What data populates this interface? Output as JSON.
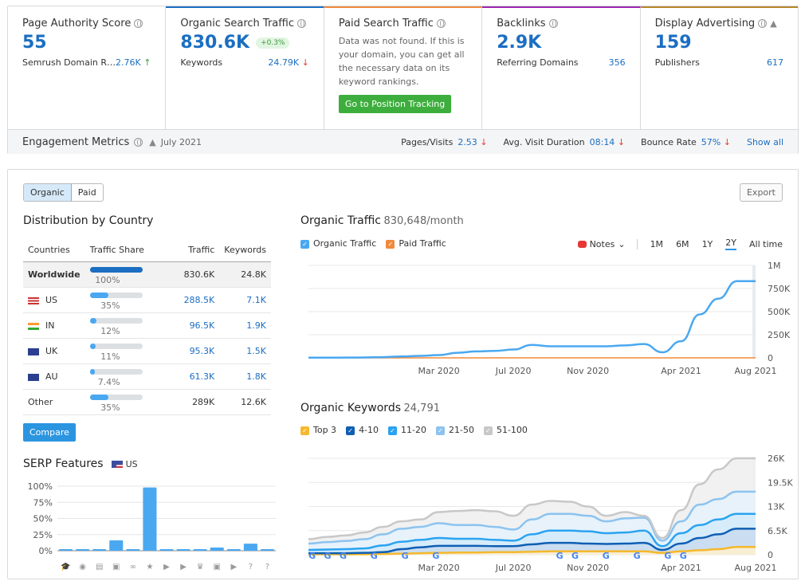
{
  "cards": [
    {
      "title": "Page Authority Score",
      "value": "55",
      "sub_label": "Semrush Domain R…",
      "sub_value": "2.76K",
      "trend": "up",
      "accent": ""
    },
    {
      "title": "Organic Search Traffic",
      "value": "830.6K",
      "badge": "+0.3%",
      "sub_label": "Keywords",
      "sub_value": "24.79K",
      "trend": "down",
      "accent": "#1b6ec2"
    },
    {
      "title": "Paid Search Traffic",
      "message": "Data was not found. If this is your domain, you can get all the necessary data on its keyword rankings.",
      "button": "Go to Position Tracking",
      "accent": "#f08a3c"
    },
    {
      "title": "Backlinks",
      "value": "2.9K",
      "sub_label": "Referring Domains",
      "sub_value": "356",
      "accent": "#9c27b0"
    },
    {
      "title": "Display Advertising",
      "value": "159",
      "sub_label": "Publishers",
      "sub_value": "617",
      "accent": "#b8862b"
    }
  ],
  "engagement": {
    "title": "Engagement Metrics",
    "date": "July 2021",
    "pages_visits_label": "Pages/Visits",
    "pages_visits": "2.53",
    "duration_label": "Avg. Visit Duration",
    "duration": "08:14",
    "bounce_label": "Bounce Rate",
    "bounce": "57%",
    "show_all": "Show all"
  },
  "tabs": {
    "organic": "Organic",
    "paid": "Paid"
  },
  "export": "Export",
  "distribution": {
    "title": "Distribution by Country",
    "headers": [
      "Countries",
      "Traffic Share",
      "Traffic",
      "Keywords"
    ],
    "rows": [
      {
        "country": "Worldwide",
        "share": "100%",
        "traffic": "830.6K",
        "keywords": "24.8K",
        "fill": 1.0
      },
      {
        "country": "US",
        "share": "35%",
        "traffic": "288.5K",
        "keywords": "7.1K",
        "fill": 0.35
      },
      {
        "country": "IN",
        "share": "12%",
        "traffic": "96.5K",
        "keywords": "1.9K",
        "fill": 0.12
      },
      {
        "country": "UK",
        "share": "11%",
        "traffic": "95.3K",
        "keywords": "1.5K",
        "fill": 0.11
      },
      {
        "country": "AU",
        "share": "7.4%",
        "traffic": "61.3K",
        "keywords": "1.8K",
        "fill": 0.074
      },
      {
        "country": "Other",
        "share": "35%",
        "traffic": "289K",
        "keywords": "12.6K",
        "fill": 0.35
      }
    ],
    "compare": "Compare"
  },
  "serp": {
    "title": "SERP Features",
    "country": "US"
  },
  "traffic": {
    "title": "Organic Traffic",
    "subtitle": "830,648/month",
    "legend": [
      "Organic Traffic",
      "Paid Traffic"
    ],
    "notes": "Notes",
    "ranges": [
      "1M",
      "6M",
      "1Y",
      "2Y",
      "All time"
    ],
    "selected_range": "2Y"
  },
  "keywords": {
    "title": "Organic Keywords",
    "subtitle": "24,791",
    "legend": [
      "Top 3",
      "4-10",
      "11-20",
      "21-50",
      "51-100"
    ]
  },
  "chart_data": [
    {
      "type": "bar",
      "title": "SERP Features",
      "categories": [
        "featured-snippet-related",
        "local-pack",
        "news",
        "image",
        "sitelinks",
        "reviews",
        "video",
        "featured-video",
        "top-stories",
        "image-pack",
        "video-carousel",
        "faq",
        "people-also-ask"
      ],
      "values": [
        1,
        1,
        1,
        16,
        1,
        98,
        1,
        1,
        2,
        5,
        1,
        11,
        1
      ],
      "yticks": [
        "100%",
        "75%",
        "50%",
        "25%",
        "0%"
      ],
      "ylim": [
        0,
        100
      ]
    },
    {
      "type": "line",
      "title": "Organic Traffic",
      "x": [
        "Aug 2019",
        "Sep 2019",
        "Oct 2019",
        "Nov 2019",
        "Dec 2019",
        "Jan 2020",
        "Feb 2020",
        "Mar 2020",
        "Apr 2020",
        "May 2020",
        "Jun 2020",
        "Jul 2020",
        "Aug 2020",
        "Sep 2020",
        "Oct 2020",
        "Nov 2020",
        "Dec 2020",
        "Jan 2021",
        "Feb 2021",
        "Mar 2021",
        "Apr 2021",
        "May 2021",
        "Jun 2021",
        "Jul 2021",
        "Aug 2021"
      ],
      "series": [
        {
          "name": "Organic Traffic",
          "values": [
            2000,
            2000,
            3000,
            4000,
            8000,
            15000,
            22000,
            30000,
            55000,
            70000,
            75000,
            90000,
            140000,
            125000,
            125000,
            125000,
            125000,
            135000,
            150000,
            60000,
            180000,
            470000,
            640000,
            830000,
            830000
          ]
        },
        {
          "name": "Paid Traffic",
          "values": [
            0,
            0,
            0,
            0,
            0,
            0,
            0,
            0,
            0,
            0,
            0,
            0,
            0,
            0,
            0,
            0,
            0,
            0,
            0,
            0,
            0,
            0,
            0,
            0,
            0
          ]
        }
      ],
      "xticks": [
        "Mar 2020",
        "Jul 2020",
        "Nov 2020",
        "Apr 2021",
        "Aug 2021"
      ],
      "yticks": [
        "1M",
        "750K",
        "500K",
        "250K",
        "0"
      ],
      "ylim": [
        0,
        1000000
      ]
    },
    {
      "type": "area",
      "title": "Organic Keywords",
      "x": [
        "Aug 2019",
        "Sep 2019",
        "Oct 2019",
        "Nov 2019",
        "Dec 2019",
        "Jan 2020",
        "Feb 2020",
        "Mar 2020",
        "Apr 2020",
        "May 2020",
        "Jun 2020",
        "Jul 2020",
        "Aug 2020",
        "Sep 2020",
        "Oct 2020",
        "Nov 2020",
        "Dec 2020",
        "Jan 2021",
        "Feb 2021",
        "Mar 2021",
        "Apr 2021",
        "May 2021",
        "Jun 2021",
        "Jul 2021",
        "Aug 2021"
      ],
      "series": [
        {
          "name": "Top 3",
          "color": "#f5b82e",
          "values": [
            100,
            100,
            100,
            100,
            200,
            300,
            400,
            500,
            600,
            600,
            700,
            700,
            800,
            900,
            900,
            900,
            900,
            900,
            900,
            500,
            900,
            1200,
            1500,
            2100,
            2100
          ]
        },
        {
          "name": "4-10",
          "color": "#0f5fb3",
          "values": [
            400,
            400,
            400,
            500,
            700,
            1500,
            2000,
            2400,
            2400,
            2400,
            2300,
            2300,
            2800,
            3200,
            3200,
            3000,
            2900,
            3000,
            3200,
            1300,
            3000,
            4500,
            5500,
            7000,
            7000
          ]
        },
        {
          "name": "11-20",
          "color": "#2aa3f0",
          "values": [
            1300,
            1400,
            1500,
            1700,
            2500,
            3500,
            4000,
            4500,
            4300,
            4300,
            4000,
            3800,
            5500,
            6500,
            6500,
            6300,
            5800,
            6000,
            6500,
            2300,
            5800,
            8000,
            9500,
            11000,
            11000
          ]
        },
        {
          "name": "21-50",
          "color": "#8cc3ef",
          "values": [
            3000,
            3400,
            3700,
            4200,
            5500,
            7000,
            7500,
            8500,
            8000,
            8000,
            7500,
            6800,
            9500,
            11000,
            11000,
            10500,
            9000,
            9800,
            10000,
            3800,
            9000,
            13500,
            15000,
            17000,
            17000
          ]
        },
        {
          "name": "51-100",
          "color": "#c8c8c8",
          "values": [
            4200,
            4800,
            5200,
            6000,
            7500,
            9000,
            9500,
            11500,
            11800,
            12000,
            11700,
            10500,
            13500,
            14500,
            14300,
            13000,
            10500,
            11500,
            10500,
            4500,
            12000,
            19000,
            23000,
            26000,
            26000
          ]
        }
      ],
      "xticks": [
        "Mar 2020",
        "Jul 2020",
        "Nov 2020",
        "Apr 2021",
        "Aug 2021"
      ],
      "yticks": [
        "26K",
        "19.5K",
        "13K",
        "6.5K",
        "0"
      ],
      "ylim": [
        0,
        26000
      ]
    }
  ]
}
